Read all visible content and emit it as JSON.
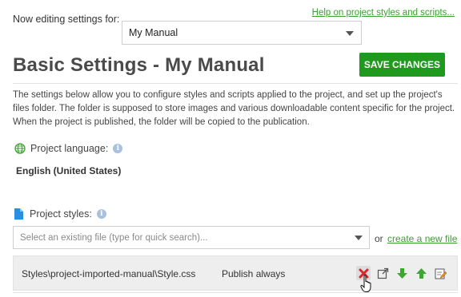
{
  "header": {
    "editing_label": "Now editing settings for:",
    "selected_manual": "My Manual",
    "help_link": "Help on project styles and scripts..."
  },
  "page": {
    "title": "Basic Settings - My Manual",
    "save_label": "SAVE CHANGES",
    "description": "The settings below allow you to configure styles and scripts applied to the project, and set up the project's files folder. The folder is supposed to store images and various downloadable content specific for the project. When the project is published, the folder will be copied to the publication."
  },
  "language": {
    "label": "Project language:",
    "value": "English (United States)",
    "icon": "globe-icon"
  },
  "styles": {
    "label": "Project styles:",
    "search_placeholder": "Select an existing file (type for quick search)...",
    "or_text": "or",
    "create_link": "create a new file",
    "rows": [
      {
        "path": "Styles\\project-imported-manual\\Style.css",
        "mode": "Publish always"
      }
    ]
  },
  "colors": {
    "accent": "#1f9a1f",
    "link": "#3aa02f",
    "delete": "#d9262b",
    "arrow": "#3fa535"
  }
}
